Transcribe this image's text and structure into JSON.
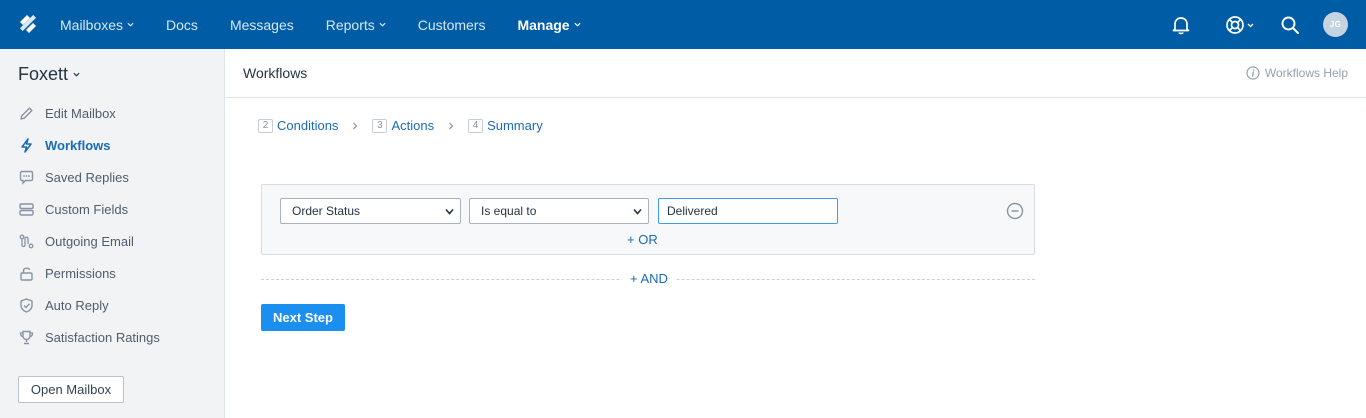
{
  "topnav": {
    "items": [
      {
        "label": "Mailboxes",
        "has_caret": true
      },
      {
        "label": "Docs",
        "has_caret": false
      },
      {
        "label": "Messages",
        "has_caret": false
      },
      {
        "label": "Reports",
        "has_caret": true
      },
      {
        "label": "Customers",
        "has_caret": false
      },
      {
        "label": "Manage",
        "has_caret": true,
        "active": true
      }
    ],
    "avatar_initials": "JG",
    "icons": [
      "bell-icon",
      "help-lifebuoy-icon",
      "search-icon"
    ],
    "bg_color": "#005ca4"
  },
  "sidebar": {
    "mailbox_name": "Foxett",
    "items": [
      {
        "label": "Edit Mailbox",
        "icon": "pencil-icon"
      },
      {
        "label": "Workflows",
        "icon": "lightning-icon",
        "active": true
      },
      {
        "label": "Saved Replies",
        "icon": "speech-bubble-icon"
      },
      {
        "label": "Custom Fields",
        "icon": "fields-icon"
      },
      {
        "label": "Outgoing Email",
        "icon": "route-icon"
      },
      {
        "label": "Permissions",
        "icon": "lock-icon"
      },
      {
        "label": "Auto Reply",
        "icon": "shield-check-icon"
      },
      {
        "label": "Satisfaction Ratings",
        "icon": "trophy-icon"
      }
    ],
    "open_mailbox_label": "Open Mailbox"
  },
  "main": {
    "title": "Workflows",
    "help_label": "Workflows Help",
    "steps": [
      {
        "num": "2",
        "label": "Conditions"
      },
      {
        "num": "3",
        "label": "Actions"
      },
      {
        "num": "4",
        "label": "Summary"
      }
    ],
    "condition": {
      "field": "Order Status",
      "operator": "Is equal to",
      "value": "Delivered",
      "or_label": "+ OR"
    },
    "and_label": "+ AND",
    "next_label": "Next Step",
    "accent_color": "#1b8ff0"
  }
}
